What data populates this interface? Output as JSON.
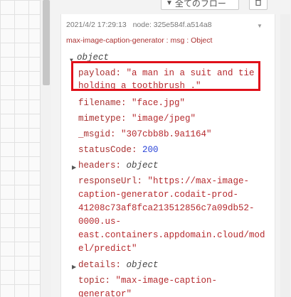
{
  "toolbar": {
    "flows_button_label": "全てのフロー",
    "flows_icon": "filter-icon",
    "delete_icon": "trash-icon"
  },
  "message": {
    "timestamp": "2021/4/2 17:29:13",
    "node_label": "node: 325e584f.a514a8",
    "topic_path": "max-image-caption-generator : msg : Object",
    "root_type": "object",
    "payload_key": "payload",
    "payload_line1": "\"a man in a suit and tie",
    "payload_line2": "holding a toothbrush .\"",
    "filename_key": "filename",
    "filename_value": "\"face.jpg\"",
    "mimetype_key": "mimetype",
    "mimetype_value": "\"image/jpeg\"",
    "msgid_key": "_msgid",
    "msgid_value": "\"307cbb8b.9a1164\"",
    "statuscode_key": "statusCode",
    "statuscode_value": "200",
    "headers_key": "headers",
    "headers_type": "object",
    "responseurl_key": "responseUrl",
    "responseurl_line1": "\"https://max-image-",
    "responseurl_line2": "caption-generator.codait-prod-",
    "responseurl_line3": "41208c73af8fca213512856c7a09db52-",
    "responseurl_line4": "0000.us-",
    "responseurl_line5": "east.containers.appdomain.cloud/mod",
    "responseurl_line6": "el/predict\"",
    "details_key": "details",
    "details_type": "object",
    "topic_key": "topic",
    "topic_line1": "\"max-image-caption-",
    "topic_line2": "generator\""
  },
  "colors": {
    "highlight": "#e0101a",
    "key": "#aa3131",
    "number": "#2a44d8"
  }
}
